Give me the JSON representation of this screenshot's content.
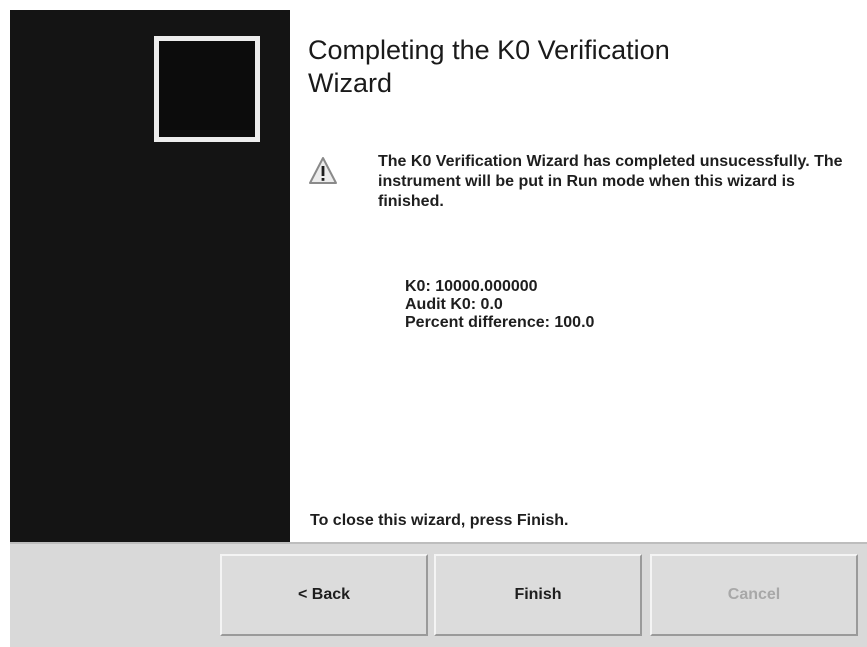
{
  "wizard": {
    "title": "Completing the K0 Verification Wizard",
    "message": "The K0 Verification Wizard has completed unsucessfully. The instrument will be put in Run mode when this wizard is finished.",
    "results": {
      "k0": "K0: 10000.000000",
      "audit_k0": "Audit K0: 0.0",
      "percent_difference": "Percent difference: 100.0"
    },
    "footer_text": "To close this wizard, press Finish.",
    "icons": {
      "warning": "warning-icon"
    }
  },
  "buttons": {
    "back_label": "< Back",
    "finish_label": "Finish",
    "cancel_label": "Cancel"
  }
}
